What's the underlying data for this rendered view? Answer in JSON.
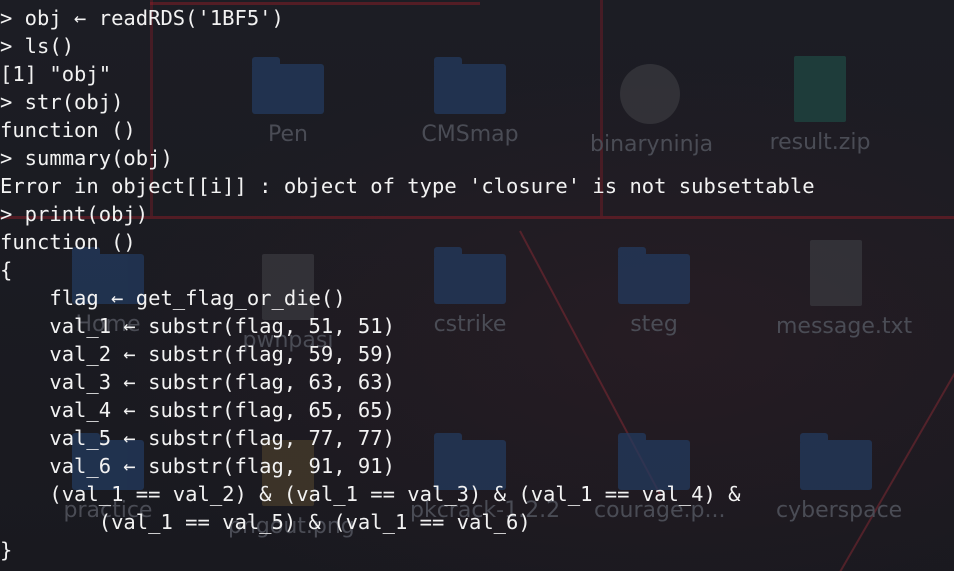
{
  "theme": {
    "background": "#1a1c22",
    "text": "#f2f2f2",
    "desktop_label": "#4a4c55",
    "folder": "#233a5e"
  },
  "desktop": {
    "icons": [
      {
        "label": "Pen",
        "kind": "folder"
      },
      {
        "label": "CMSmap",
        "kind": "folder"
      },
      {
        "label": "binaryninja",
        "kind": "app"
      },
      {
        "label": "result.zip",
        "kind": "archive"
      },
      {
        "label": "Home",
        "kind": "folder"
      },
      {
        "label": "pwnpasi",
        "kind": "folder"
      },
      {
        "label": "cstrike",
        "kind": "folder"
      },
      {
        "label": "steg",
        "kind": "folder"
      },
      {
        "label": "message.txt",
        "kind": "file"
      },
      {
        "label": "practice",
        "kind": "folder"
      },
      {
        "label": "pngout.png",
        "kind": "file"
      },
      {
        "label": "pkcrack-1.2.2",
        "kind": "folder"
      },
      {
        "label": "courage.p...",
        "kind": "file"
      },
      {
        "label": "cyberspace",
        "kind": "folder"
      }
    ]
  },
  "terminal": {
    "lines": [
      "> obj ← readRDS('1BF5')",
      "> ls()",
      "[1] \"obj\"",
      "> str(obj)",
      "function ()",
      "> summary(obj)",
      "Error in object[[i]] : object of type 'closure' is not subsettable",
      "> print(obj)",
      "function ()",
      "{",
      "    flag ← get_flag_or_die()",
      "    val_1 ← substr(flag, 51, 51)",
      "    val_2 ← substr(flag, 59, 59)",
      "    val_3 ← substr(flag, 63, 63)",
      "    val_4 ← substr(flag, 65, 65)",
      "    val_5 ← substr(flag, 77, 77)",
      "    val_6 ← substr(flag, 91, 91)",
      "    (val_1 == val_2) & (val_1 == val_3) & (val_1 == val_4) &",
      "        (val_1 == val_5) & (val_1 == val_6)",
      "}"
    ]
  }
}
